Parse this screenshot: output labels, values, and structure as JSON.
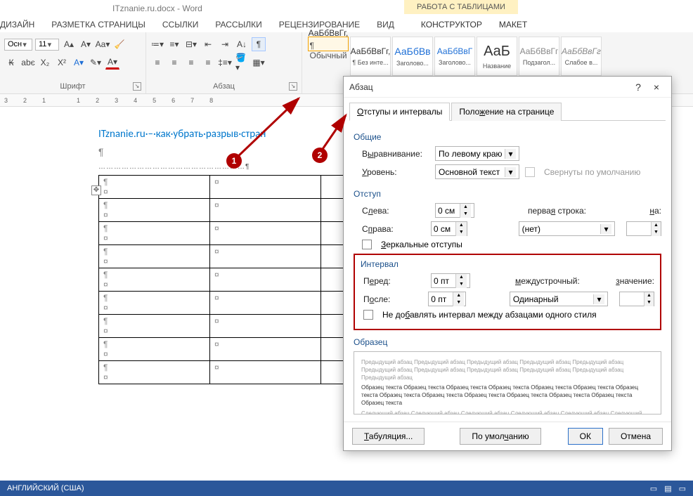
{
  "title": "ITznanie.ru.docx - Word",
  "table_tools": "РАБОТА С ТАБЛИЦАМИ",
  "tabs": {
    "dizain": "ДИЗАЙН",
    "razmetka": "РАЗМЕТКА СТРАНИЦЫ",
    "ssylki": "ССЫЛКИ",
    "rassylki": "РАССЫЛКИ",
    "review": "РЕЦЕНЗИРОВАНИЕ",
    "vid": "ВИД",
    "konstr": "КОНСТРУКТОР",
    "maket": "МАКЕТ"
  },
  "ribbon": {
    "font_name": "Осн",
    "font_size": "11",
    "font_group": "Шрифт",
    "para_group": "Абзац",
    "styles": [
      {
        "prev": "АаБбВвГг,",
        "name": "¶ Обычный"
      },
      {
        "prev": "АаБбВвГг,",
        "name": "¶ Без инте..."
      },
      {
        "prev": "АаБбВв",
        "name": "Заголово..."
      },
      {
        "prev": "АаБбВвГ",
        "name": "Заголово..."
      },
      {
        "prev": "АаБ",
        "name": "Название"
      },
      {
        "prev": "АаБбВвГг",
        "name": "Подзагол..."
      },
      {
        "prev": "АаБбВвГг",
        "name": "Слабое в..."
      }
    ]
  },
  "ruler_marks": [
    "3",
    "2",
    "1",
    "",
    "1",
    "2",
    "3",
    "4",
    "5",
    "6",
    "7",
    "8"
  ],
  "doc": {
    "headline": "ITznanie.ru·–·как·убрать·разрыв·стран",
    "pilcrow": "¶",
    "dots": "…………………………………………………¶",
    "cell": "¶"
  },
  "dialog": {
    "title": "Абзац",
    "help": "?",
    "close": "×",
    "tab1": "Отступы и интервалы",
    "tab2": "Положение на странице",
    "general": "Общие",
    "align_label": "Выравнивание:",
    "align_value": "По левому краю",
    "level_label": "Уровень:",
    "level_value": "Основной текст",
    "collapse_default": "Свернуты по умолчанию",
    "indent": "Отступ",
    "left_label": "Слева:",
    "left_value": "0 см",
    "right_label": "Справа:",
    "right_value": "0 см",
    "firstline_label": "первая строка:",
    "firstline_value": "(нет)",
    "on_label": "на:",
    "on_value": "",
    "mirror": "Зеркальные отступы",
    "interval": "Интервал",
    "before_label": "Перед:",
    "before_value": "0 пт",
    "after_label": "После:",
    "after_value": "0 пт",
    "linespacing_label": "междустрочный:",
    "linespacing_value": "Одинарный",
    "value_label": "значение:",
    "value_value": "",
    "noaddspace": "Не добавлять интервал между абзацами одного стиля",
    "sample": "Образец",
    "preview_prev": "Предыдущий абзац Предыдущий абзац Предыдущий абзац Предыдущий абзац Предыдущий абзац Предыдущий абзац Предыдущий абзац Предыдущий абзац Предыдущий абзац Предыдущий абзац Предыдущий абзац",
    "preview_main": "Образец текста Образец текста Образец текста Образец текста Образец текста Образец текста Образец текста Образец текста Образец текста Образец текста Образец текста Образец текста Образец текста Образец текста",
    "preview_next": "Следующий абзац Следующий абзац Следующий абзац Следующий абзац Следующий абзац Следующий абзац",
    "tabulation": "Табуляция...",
    "default": "По умолчанию",
    "ok": "ОК",
    "cancel": "Отмена"
  },
  "status": {
    "lang": "АНГЛИЙСКИЙ (США)"
  },
  "annot": {
    "b1": "1",
    "b2": "2"
  }
}
